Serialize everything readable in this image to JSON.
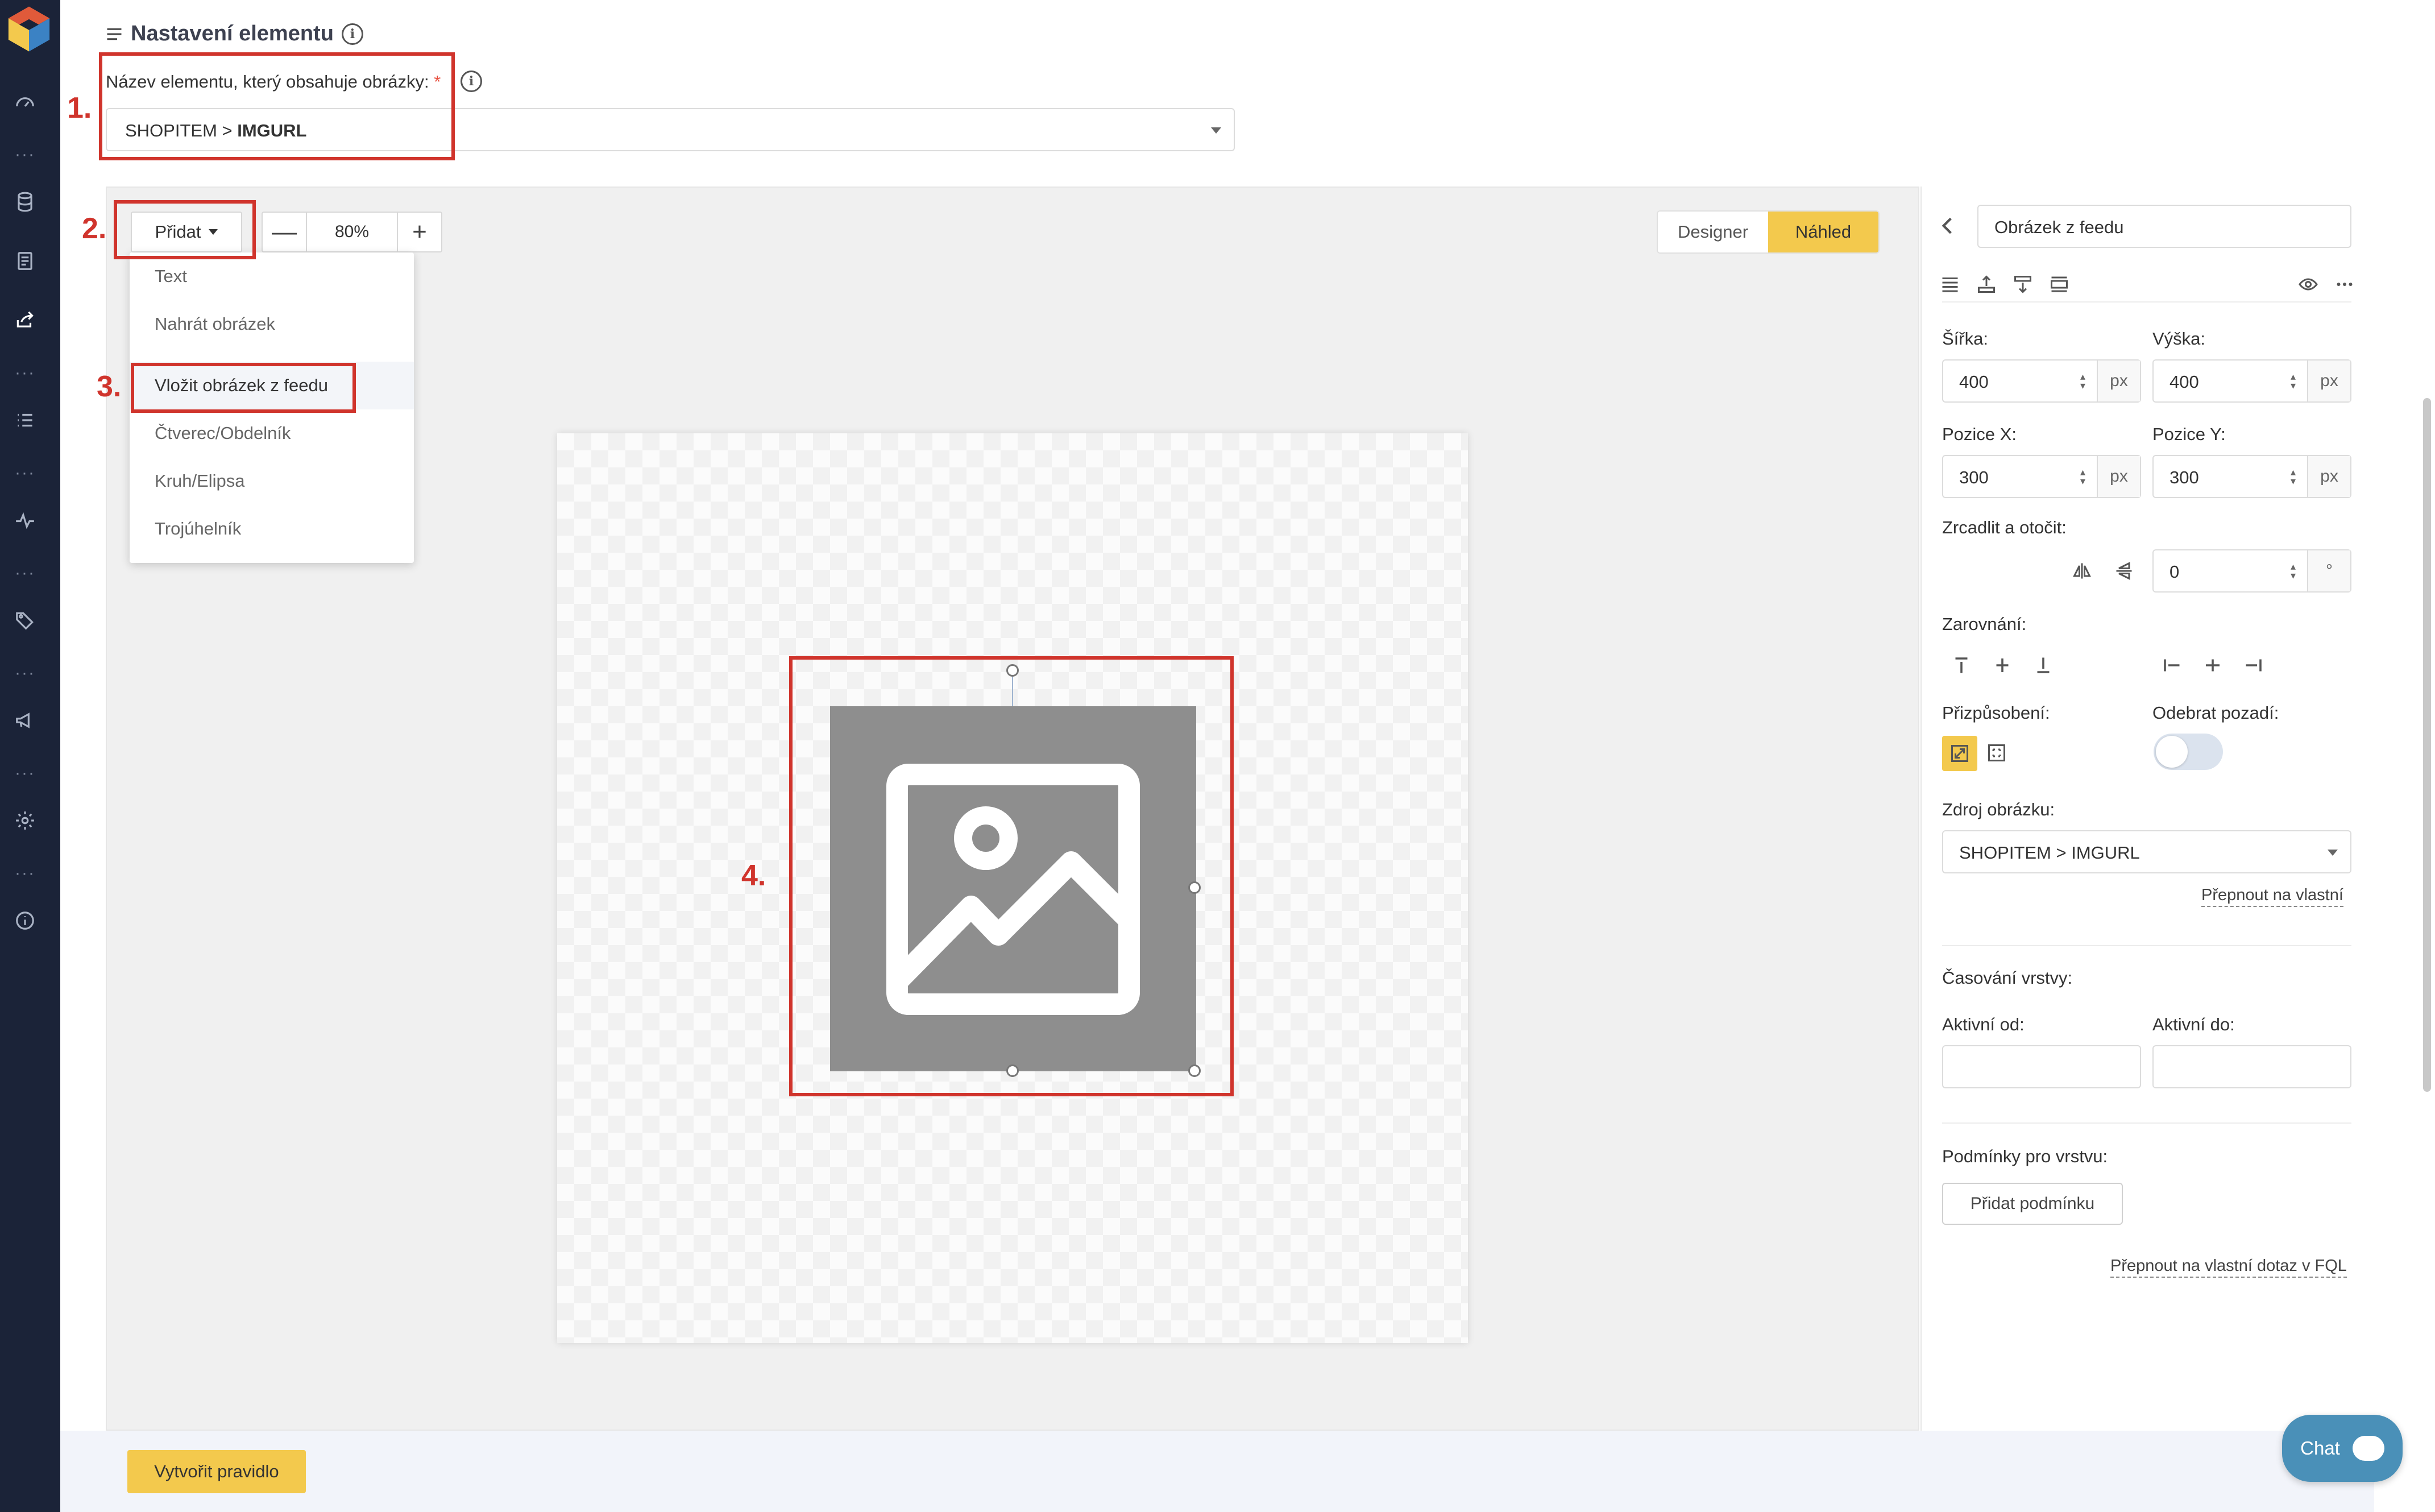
{
  "app": {
    "brand_colors": {
      "sidebar": "#1b2338",
      "accent": "#f3c94d",
      "annotation": "#d0342c"
    }
  },
  "sidebar": {
    "icons": [
      "dashboard-icon",
      "database-icon",
      "document-icon",
      "export-icon",
      "list-icon",
      "activity-icon",
      "tag-icon",
      "megaphone-icon",
      "gear-icon",
      "info-icon"
    ]
  },
  "header": {
    "title": "Nastavení elementu",
    "element_label": "Název elementu, který obsahuje obrázky:",
    "required_mark": "*",
    "element_value_prefix": "SHOPITEM > ",
    "element_value_strong": "IMGURL"
  },
  "annotations": [
    "1.",
    "2.",
    "3.",
    "4."
  ],
  "toolbar": {
    "add_label": "Přidat",
    "zoom_value": "80%",
    "zoom_minus": "—",
    "zoom_plus": "+",
    "view_designer": "Designer",
    "view_preview": "Náhled"
  },
  "add_menu": {
    "items": [
      "Text",
      "Nahrát obrázek",
      "Vložit obrázek z feedu",
      "Čtverec/Obdelník",
      "Kruh/Elipsa",
      "Trojúhelník"
    ],
    "selected": "Vložit obrázek z feedu"
  },
  "panel": {
    "layer_name": "Obrázek z feedu",
    "width_label": "Šířka:",
    "width_value": "400",
    "height_label": "Výška:",
    "height_value": "400",
    "unit": "px",
    "pos_x_label": "Pozice X:",
    "pos_x_value": "300",
    "pos_y_label": "Pozice Y:",
    "pos_y_value": "300",
    "mirror_label": "Zrcadlit a otočit:",
    "rotation_value": "0",
    "degree_unit": "°",
    "align_label": "Zarovnání:",
    "fit_label": "Přizpůsobení:",
    "remove_bg_label": "Odebrat pozadí:",
    "remove_bg_on": false,
    "source_label": "Zdroj obrázku:",
    "source_value": "SHOPITEM > IMGURL",
    "switch_custom": "Přepnout na vlastní",
    "timing_label": "Časování vrstvy:",
    "active_from_label": "Aktivní od:",
    "active_to_label": "Aktivní do:",
    "conditions_label": "Podmínky pro vrstvu:",
    "add_condition": "Přidat podmínku",
    "switch_fql": "Přepnout na vlastní dotaz v FQL"
  },
  "footer": {
    "create_rule": "Vytvořit pravidlo",
    "chat_label": "Chat"
  }
}
